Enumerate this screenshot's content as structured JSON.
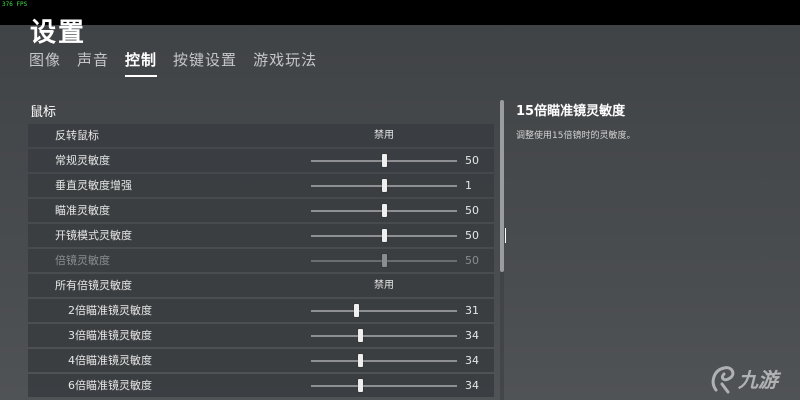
{
  "fps": "376 FPS",
  "title": "设置",
  "tabs": [
    {
      "label": "图像",
      "active": false
    },
    {
      "label": "声音",
      "active": false
    },
    {
      "label": "控制",
      "active": true
    },
    {
      "label": "按键设置",
      "active": false
    },
    {
      "label": "游戏玩法",
      "active": false
    }
  ],
  "section": {
    "title": "鼠标"
  },
  "rows": [
    {
      "label": "反转鼠标",
      "type": "toggle",
      "value": "禁用"
    },
    {
      "label": "常规灵敏度",
      "type": "slider",
      "value": "50",
      "level": 0.5
    },
    {
      "label": "垂直灵敏度增强",
      "type": "slider",
      "value": "1",
      "level": 0.5
    },
    {
      "label": "瞄准灵敏度",
      "type": "slider",
      "value": "50",
      "level": 0.5
    },
    {
      "label": "开镜模式灵敏度",
      "type": "slider",
      "value": "50",
      "level": 0.5,
      "editing": true
    },
    {
      "label": "倍镜灵敏度",
      "type": "slider",
      "value": "50",
      "level": 0.5,
      "disabled": true
    },
    {
      "label": "所有倍镜灵敏度",
      "type": "toggle",
      "value": "禁用"
    },
    {
      "label": "2倍瞄准镜灵敏度",
      "type": "slider",
      "value": "31",
      "level": 0.31,
      "sub": true
    },
    {
      "label": "3倍瞄准镜灵敏度",
      "type": "slider",
      "value": "34",
      "level": 0.34,
      "sub": true
    },
    {
      "label": "4倍瞄准镜灵敏度",
      "type": "slider",
      "value": "34",
      "level": 0.34,
      "sub": true
    },
    {
      "label": "6倍瞄准镜灵敏度",
      "type": "slider",
      "value": "34",
      "level": 0.34,
      "sub": true
    }
  ],
  "detail": {
    "title": "15倍瞄准镜灵敏度",
    "description": "调整使用15倍镜时的灵敏度。"
  },
  "watermark": {
    "text": "九游",
    "icon": "jiuyou-logo-icon"
  },
  "colors": {
    "fps": "#3fe04a",
    "active_tab": "#ffffff"
  }
}
